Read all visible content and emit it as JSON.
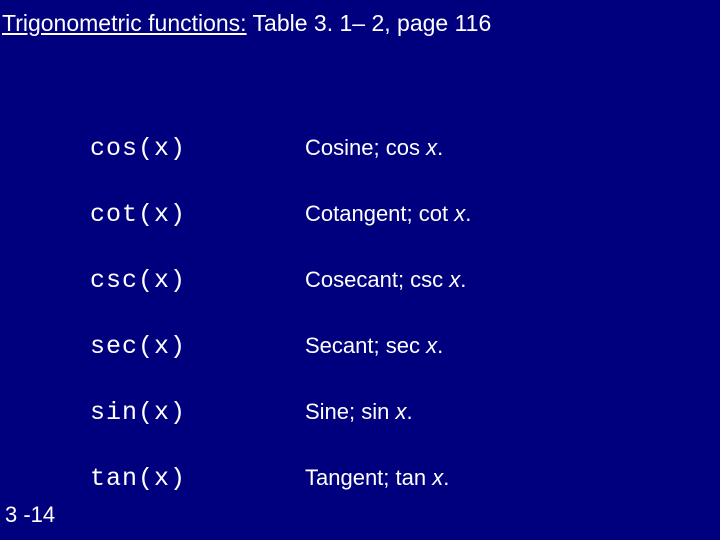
{
  "title": {
    "underlined": "Trigonometric functions:",
    "rest": " Table 3. 1– 2, page 116"
  },
  "rows": [
    {
      "func": "cos(x)",
      "name": "Cosine; ",
      "abbr": "cos ",
      "var": "x",
      "tail": "."
    },
    {
      "func": "cot(x)",
      "name": "Cotangent; ",
      "abbr": "cot ",
      "var": "x",
      "tail": "."
    },
    {
      "func": "csc(x)",
      "name": "Cosecant; ",
      "abbr": "csc ",
      "var": "x",
      "tail": "."
    },
    {
      "func": "sec(x)",
      "name": "Secant; ",
      "abbr": "sec ",
      "var": "x",
      "tail": "."
    },
    {
      "func": "sin(x)",
      "name": "Sine; ",
      "abbr": "sin ",
      "var": "x",
      "tail": "."
    },
    {
      "func": "tan(x)",
      "name": "Tangent; ",
      "abbr": "tan ",
      "var": "x",
      "tail": "."
    }
  ],
  "slide_number": "3 -14"
}
